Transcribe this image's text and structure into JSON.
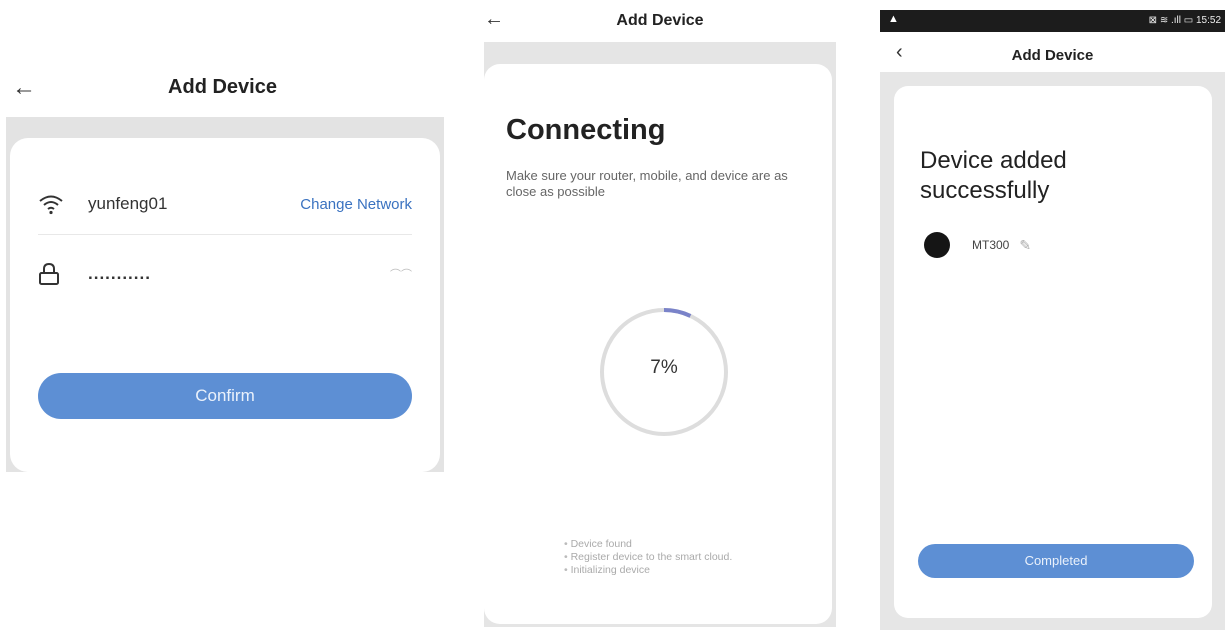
{
  "panel1": {
    "title": "Add Device",
    "back_icon": "arrow-left-icon",
    "network_name": "yunfeng01",
    "change_network_label": "Change Network",
    "password_value": "...........",
    "confirm_label": "Confirm"
  },
  "panel2": {
    "title": "Add Device",
    "back_icon": "arrow-left-icon",
    "heading": "Connecting",
    "note": "Make sure your router, mobile, and device are as close as possible",
    "progress_percent": 7,
    "progress_label": "7%",
    "steps": [
      "Device found",
      "Register device to the smart cloud.",
      "Initializing device"
    ]
  },
  "panel3": {
    "status_left": "▲",
    "status_right": "⊠ ≋ .ıll ▭ 15:52",
    "title": "Add Device",
    "back_icon": "chevron-left-icon",
    "heading": "Device added successfully",
    "device_name": "MT300",
    "completed_label": "Completed"
  },
  "colors": {
    "accent": "#5d8fd4",
    "link": "#3a72c0",
    "panel_bg": "#e5e5e5",
    "status_bar": "#1c1c1c"
  }
}
